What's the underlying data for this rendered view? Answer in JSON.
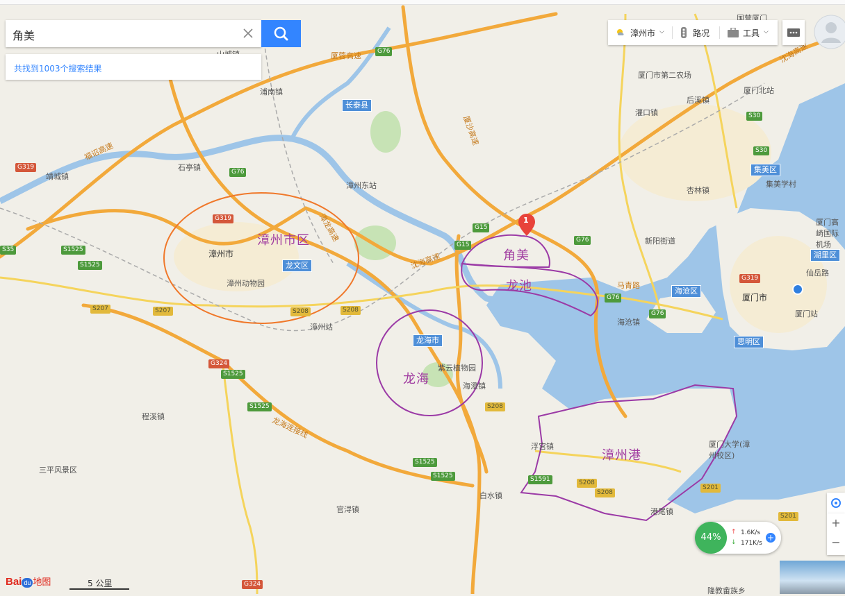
{
  "search": {
    "query": "角美",
    "results_text": "共找到1003个搜索结果"
  },
  "toolbar": {
    "city": "漳州市",
    "traffic": "路况",
    "tools": "工具"
  },
  "annotations": {
    "zhangzhou_urban": "漳州市区",
    "jiaomei": "角美",
    "longchi": "龙池",
    "longhai": "龙海",
    "zhangzhou_port": "漳州港"
  },
  "marker": {
    "number": "1"
  },
  "places": {
    "zhangzhou_city": "漳州市",
    "xiamen_city": "厦门市",
    "chengxiang": "龙海市",
    "changtai": "长泰县",
    "longwen": "龙文区",
    "longhai_city": "龙海市",
    "jimei": "集美区",
    "haicang": "海沧区",
    "huli": "湖里区",
    "siming": "思明区",
    "putou": "浦南镇",
    "shanxi": "山城镇",
    "shiting": "石亭镇",
    "jingcheng": "靖城镇",
    "zoo": "漳州动物园",
    "zz_station": "漳州站",
    "zz_east": "漳州东站",
    "ziyun": "紫云植物园",
    "haicheng": "海澄镇",
    "fugong": "浮宫镇",
    "baishui": "白水镇",
    "guanxun": "官浔镇",
    "chengxi": "程溪镇",
    "sanping": "三平风景区",
    "gangwei": "港尾镇",
    "xmu": "厦门大学(漳州校区)",
    "xm_north": "厦门北站",
    "xm_station": "厦门站",
    "xm_airport": "厦门高崎国际机场",
    "xinglin": "杏林镇",
    "houxi": "后溪镇",
    "guankou": "灌口镇",
    "xinyang": "新阳街道",
    "haicang_town": "海沧镇",
    "jimei_school": "集美学村",
    "xm_farm": "厦门市第二农场",
    "xianyue": "仙岳路",
    "maqing": "马青路",
    "guoyingxiamen": "国营厦门",
    "longhaimen": "隆教畲族乡"
  },
  "highways": [
    "G76",
    "G15",
    "G319",
    "S35",
    "S1525",
    "S207",
    "S208",
    "G324",
    "S30",
    "S201",
    "S1591"
  ],
  "road_names": {
    "shenhai": "沈海高速",
    "xiamen_cheng": "厦蓉高速",
    "zhanglong": "漳龙高速",
    "fuzhao": "福诏高速",
    "xiamen_sha": "厦沙高速",
    "longhai_hq": "龙海连接线"
  },
  "widgets": {
    "net_percent": "44%",
    "net_up": "1.6K/s",
    "net_down": "171K/s",
    "zoom_in": "+",
    "zoom_out": "−",
    "scale_label": "5 公里",
    "logo_text": "地图"
  }
}
